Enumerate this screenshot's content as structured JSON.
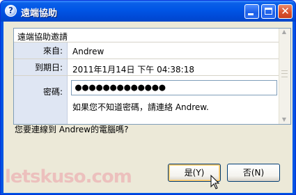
{
  "window": {
    "title": "遠端協助",
    "title_icon": "help-question-icon"
  },
  "panel": {
    "header": "遠端協助邀請",
    "from_label": "來自:",
    "from_value": "Andrew",
    "expires_label": "到期日:",
    "expires_value": "2011年1月14日 下午 04:38:18",
    "password_label": "密碼:",
    "password_value": "●●●●●●●●●●●●●",
    "password_hint": "如果您不知道密碼，請連絡 Andrew."
  },
  "question": "您要連線到 Andrew的電腦嗎?",
  "buttons": {
    "yes": "是(Y)",
    "no": "否(N)"
  },
  "watermark": "letskuso.com",
  "colors": {
    "titlebar": "#0054e3",
    "client": "#ece9d8",
    "label_bg": "#dfe6f3",
    "close_button": "#d9512e"
  }
}
